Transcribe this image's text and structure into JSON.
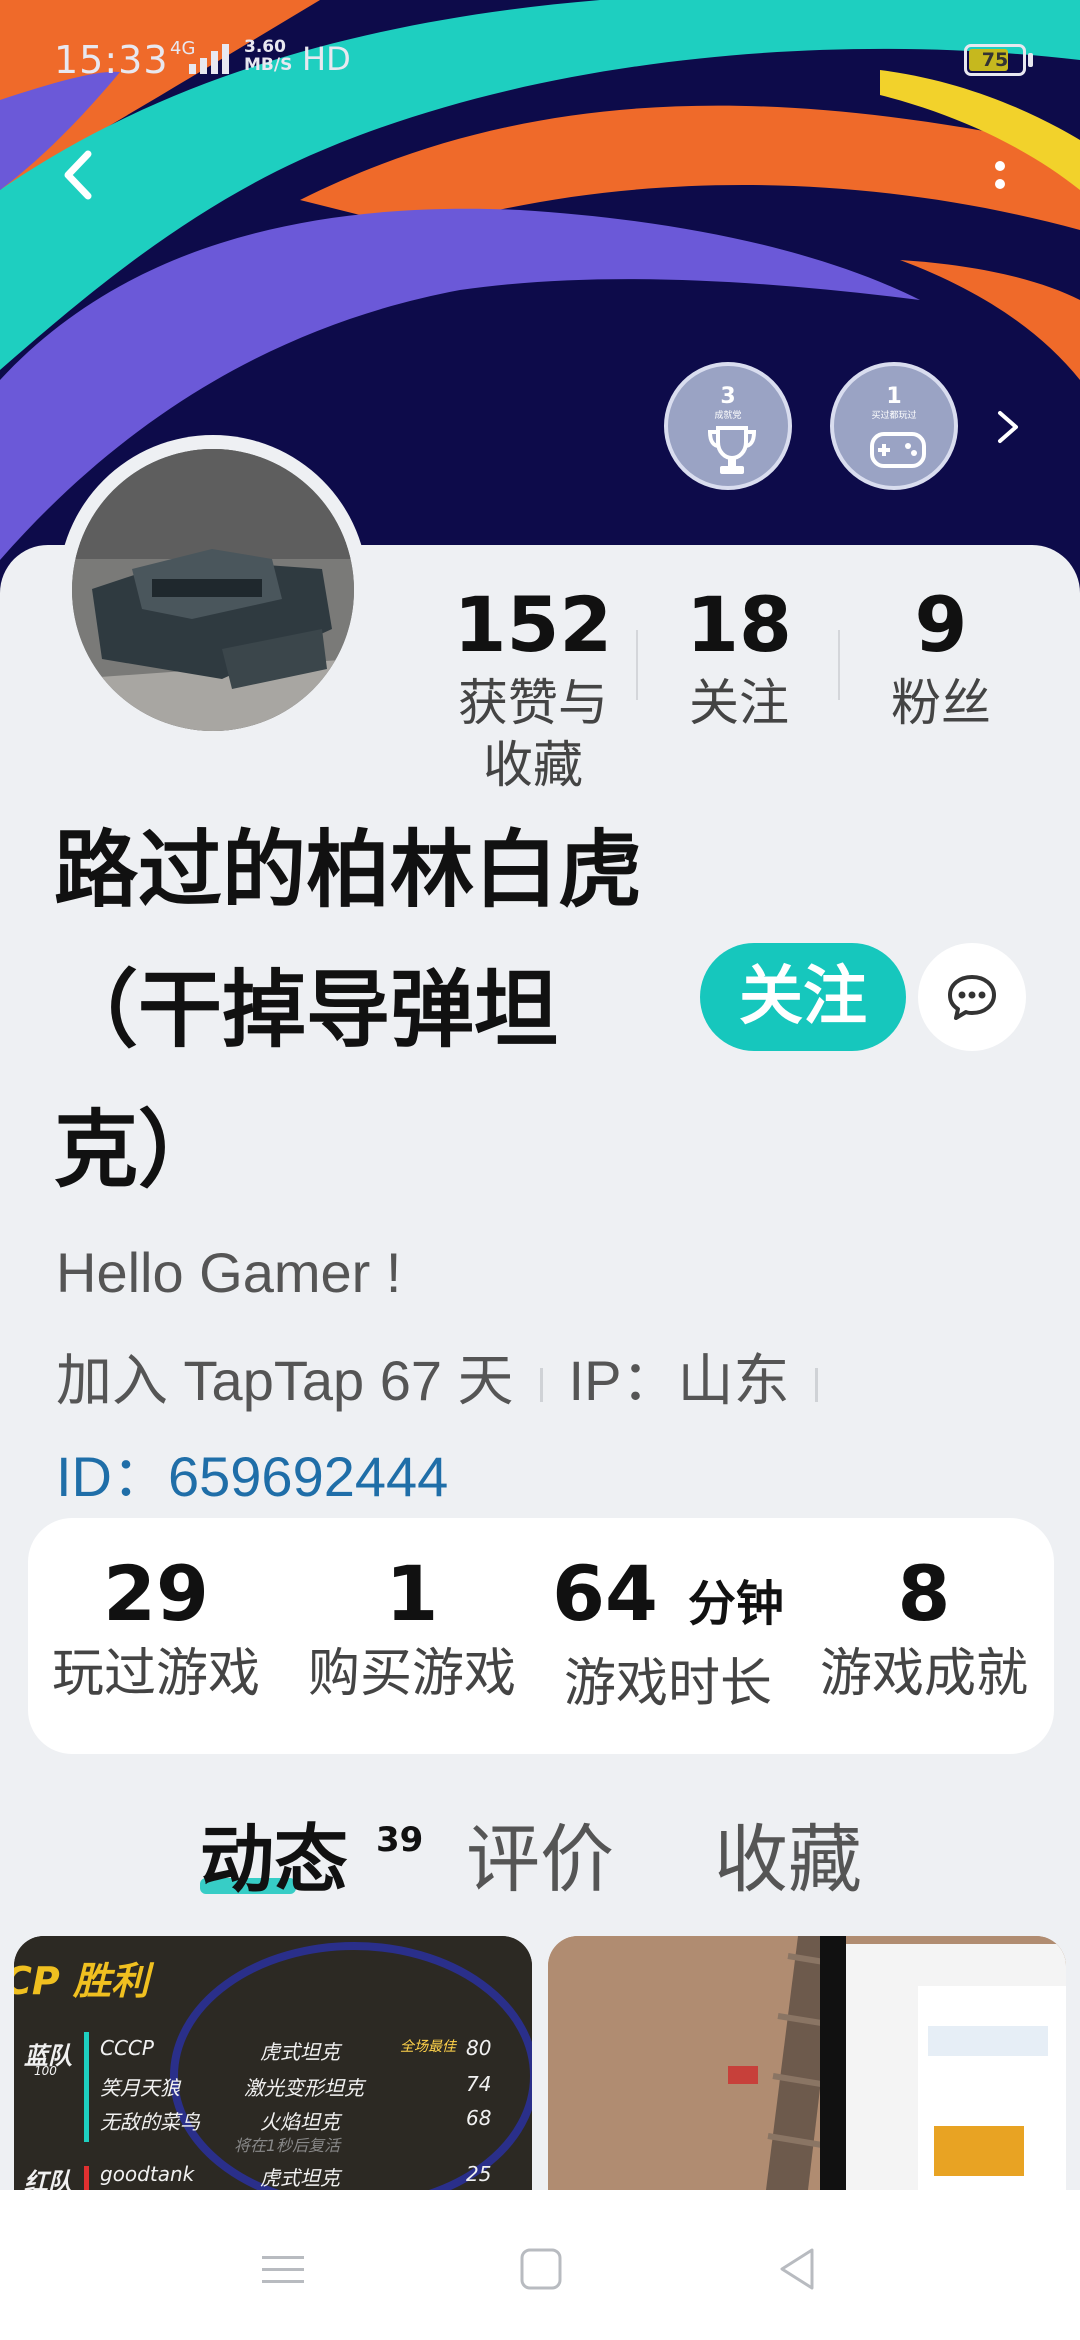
{
  "status_bar": {
    "time": "15:33",
    "network": "4G",
    "speed_value": "3.60",
    "speed_unit": "MB/S",
    "hd": "HD",
    "battery": "75",
    "battery_level": 0.75
  },
  "badges": [
    {
      "count": "3",
      "label": "成就党"
    },
    {
      "count": "1",
      "label": "买过都玩过"
    }
  ],
  "profile": {
    "stats": [
      {
        "value": "152",
        "label_line1": "获赞与",
        "label_line2": "收藏"
      },
      {
        "value": "18",
        "label_line1": "关注",
        "label_line2": ""
      },
      {
        "value": "9",
        "label_line1": "粉丝",
        "label_line2": ""
      }
    ],
    "username_line1": "路过的柏林白虎",
    "username_line2": "（干掉导弹坦",
    "username_line3": "克）",
    "follow_label": "关注",
    "bio": "Hello Gamer !",
    "joined": "加入 TapTap 67 天",
    "ip": "IP：山东",
    "id": "ID：659692444"
  },
  "game_stats": [
    {
      "value": "29",
      "unit": "",
      "label": "玩过游戏"
    },
    {
      "value": "1",
      "unit": "",
      "label": "购买游戏"
    },
    {
      "value": "64",
      "unit": "分钟",
      "label": "游戏时长"
    },
    {
      "value": "8",
      "unit": "",
      "label": "游戏成就"
    }
  ],
  "tabs": {
    "posts": "动态",
    "posts_count": "39",
    "reviews": "评价",
    "favorites": "收藏"
  },
  "feed": {
    "thumb1": {
      "title": "CP 胜利",
      "blue_team": "蓝队",
      "blue_score": "100",
      "red_team": "红队",
      "mvp": "全场最佳",
      "watermark": "将在1秒后复活",
      "rows": [
        {
          "player": "CCCP",
          "tank": "虎式坦克",
          "score": "80"
        },
        {
          "player": "笑月天狼",
          "tank": "激光变形坦克",
          "score": "74"
        },
        {
          "player": "无敌的菜鸟",
          "tank": "火焰坦克",
          "score": "68"
        },
        {
          "player": "goodtank",
          "tank": "虎式坦克",
          "score": "25"
        }
      ]
    }
  }
}
